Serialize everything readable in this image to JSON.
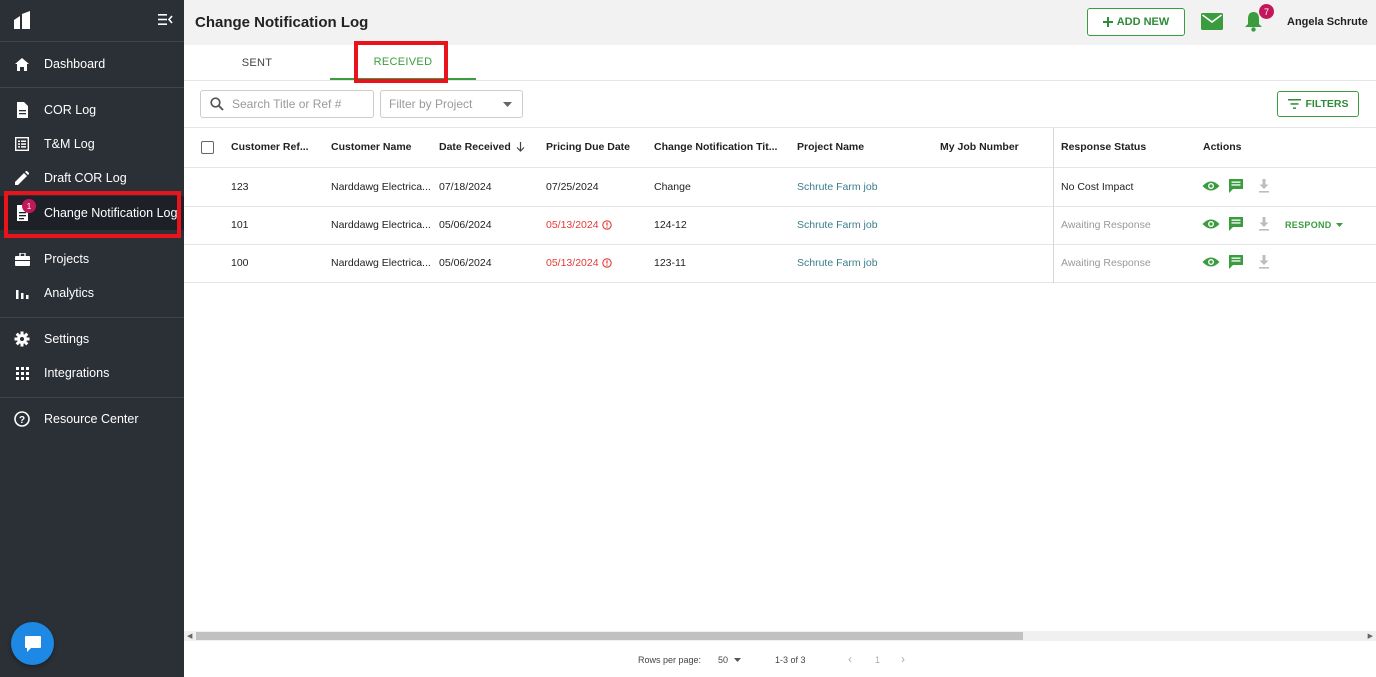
{
  "sidebar": {
    "items": [
      {
        "label": "Dashboard",
        "icon": "home-icon"
      },
      {
        "label": "COR Log",
        "icon": "document-icon"
      },
      {
        "label": "T&M Log",
        "icon": "list-icon"
      },
      {
        "label": "Draft COR Log",
        "icon": "pencil-icon"
      },
      {
        "label": "Change Notification Log",
        "icon": "notification-log-icon",
        "badge": "1"
      },
      {
        "label": "Projects",
        "icon": "briefcase-icon"
      },
      {
        "label": "Analytics",
        "icon": "bar-chart-icon"
      },
      {
        "label": "Settings",
        "icon": "gear-icon"
      },
      {
        "label": "Integrations",
        "icon": "grid-icon"
      },
      {
        "label": "Resource Center",
        "icon": "help-circle-icon"
      }
    ]
  },
  "header": {
    "title": "Change Notification Log",
    "add_new_label": "ADD NEW",
    "notification_count": "7",
    "user_name": "Angela Schrute"
  },
  "tabs": [
    {
      "label": "SENT"
    },
    {
      "label": "RECEIVED",
      "active": true
    }
  ],
  "toolbar": {
    "search_placeholder": "Search Title or Ref #",
    "project_filter_placeholder": "Filter by Project",
    "filters_label": "FILTERS"
  },
  "table": {
    "columns": [
      "Customer Ref...",
      "Customer Name",
      "Date Received",
      "Pricing Due Date",
      "Change Notification Tit...",
      "Project Name",
      "My Job Number",
      "Response Status",
      "Actions"
    ],
    "rows": [
      {
        "ref": "123",
        "customer": "Narddawg Electrica...",
        "received": "07/18/2024",
        "due": "07/25/2024",
        "due_overdue": false,
        "title": "Change",
        "project": "Schrute Farm job",
        "job": "",
        "status": "No Cost Impact",
        "status_muted": false,
        "respond": false
      },
      {
        "ref": "101",
        "customer": "Narddawg Electrica...",
        "received": "05/06/2024",
        "due": "05/13/2024",
        "due_overdue": true,
        "title": "124-12",
        "project": "Schrute Farm job",
        "job": "",
        "status": "Awaiting Response",
        "status_muted": true,
        "respond": true
      },
      {
        "ref": "100",
        "customer": "Narddawg Electrica...",
        "received": "05/06/2024",
        "due": "05/13/2024",
        "due_overdue": true,
        "title": "123-11",
        "project": "Schrute Farm job",
        "job": "",
        "status": "Awaiting Response",
        "status_muted": true,
        "respond": false
      }
    ],
    "respond_label": "RESPOND"
  },
  "pagination": {
    "rows_per_page_label": "Rows per page:",
    "rows_per_page": "50",
    "range": "1-3 of 3",
    "page": "1"
  },
  "colors": {
    "accent": "#3a9c3f",
    "sidebar_bg": "#2b2f36",
    "overdue": "#e53935",
    "badge": "#c2185b",
    "highlight": "#e8131b"
  }
}
